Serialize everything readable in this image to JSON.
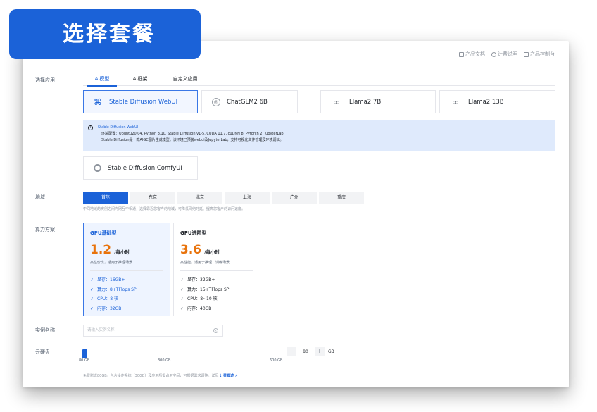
{
  "banner": {
    "title": "选择套餐"
  },
  "toplinks": [
    {
      "label": "产品文档",
      "icon": "document-icon"
    },
    {
      "label": "计费说明",
      "icon": "help-icon"
    },
    {
      "label": "产品控制台",
      "icon": "grid-icon"
    }
  ],
  "labels": {
    "app": "选择应用",
    "region": "地域",
    "compute": "算力方案",
    "instance_name": "实例名称",
    "disk": "云硬盘"
  },
  "tabs": [
    {
      "label": "AI模型",
      "active": true
    },
    {
      "label": "AI框架",
      "active": false
    },
    {
      "label": "自定义应用",
      "active": false
    }
  ],
  "models": [
    {
      "label": "Stable Diffusion WebUI",
      "icon": "stable-diffusion-icon",
      "selected": true
    },
    {
      "label": "ChatGLM2 6B",
      "icon": "chatglm-icon",
      "selected": false
    },
    {
      "label": "Llama2 7B",
      "icon": "meta-icon",
      "selected": false
    },
    {
      "label": "Llama2 13B",
      "icon": "meta-icon",
      "selected": false
    }
  ],
  "info": {
    "title": "Stable Diffusion WebUI",
    "env": "环境配置：Ubuntu20.04, Python 3.10, Stable Diffusion v1-5, CUDA 11.7, cuDNN 8, Pytorch 2, JupyterLab",
    "desc": "Stable Diffusion是一款AIGC图片生成模型。该环境已预装webui及JupyterLab，支持可视化文件管理及环境调试。"
  },
  "extra_model": {
    "label": "Stable Diffusion ComfyUI",
    "icon": "comfyui-icon"
  },
  "regions": [
    {
      "label": "首尔",
      "active": true
    },
    {
      "label": "东京",
      "active": false
    },
    {
      "label": "北京",
      "active": false
    },
    {
      "label": "上海",
      "active": false
    },
    {
      "label": "广州",
      "active": false
    },
    {
      "label": "重庆",
      "active": false
    }
  ],
  "region_hint": "不同地域的实例之间内网互不相通；选择靠近您客户的地域，可降低网络时延、提高您客户的访问速度。",
  "plans": [
    {
      "title": "GPU基础型",
      "price": "1.2",
      "unit": "/每小时",
      "desc": "高性价比，适用于推理场景",
      "selected": true,
      "features": [
        "显存：16GB+",
        "算力：8+TFlops SP",
        "CPU：8 核",
        "内存：32GB"
      ]
    },
    {
      "title": "GPU进阶型",
      "price": "3.6",
      "unit": "/每小时",
      "desc": "高性能，适用于推理、训练场景",
      "selected": false,
      "features": [
        "显存：32GB+",
        "算力：15+TFlops SP",
        "CPU：8~10 核",
        "内存：40GB"
      ]
    }
  ],
  "instance": {
    "placeholder": "请输入实例名称"
  },
  "disk": {
    "min_label": "80 GB",
    "mid_label": "300 GB",
    "max_label": "600 GB",
    "value": "80",
    "unit": "GB",
    "minus": "−",
    "plus": "+",
    "slider_fraction": 0.0
  },
  "note": {
    "text": "免费赠送80GB。包含操作系统（30GB）及应用所需占用空间，可根据需求调整。详见",
    "link": "计费概述"
  },
  "colors": {
    "accent": "#1b62d8",
    "price": "#e8730c",
    "info_bg": "#dfeafc"
  }
}
